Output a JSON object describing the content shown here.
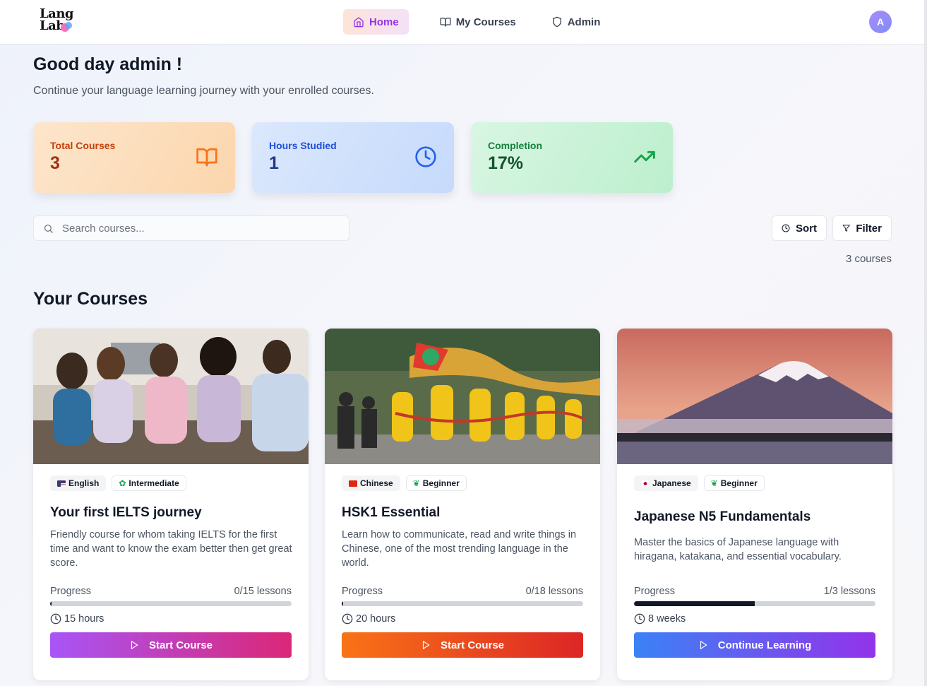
{
  "header": {
    "logo_line1": "Lang",
    "logo_line2": "Lab",
    "nav": [
      {
        "label": "Home",
        "active": true
      },
      {
        "label": "My Courses",
        "active": false
      },
      {
        "label": "Admin",
        "active": false
      }
    ],
    "avatar_initial": "A"
  },
  "greeting": "Good day admin !",
  "subtitle": "Continue your language learning journey with your enrolled courses.",
  "stats": [
    {
      "label": "Total Courses",
      "value": "3",
      "icon": "book-open-icon"
    },
    {
      "label": "Hours Studied",
      "value": "1",
      "icon": "clock-icon"
    },
    {
      "label": "Completion",
      "value": "17%",
      "icon": "trending-up-icon"
    }
  ],
  "search": {
    "placeholder": "Search courses..."
  },
  "controls": {
    "sort_label": "Sort",
    "filter_label": "Filter",
    "count_text": "3 courses"
  },
  "section_title": "Your Courses",
  "courses": [
    {
      "language": "English",
      "level": "Intermediate",
      "title": "Your first IELTS journey",
      "description": "Friendly course for whom taking IELTS for the first time and want to know the exam better then get great score.",
      "progress_label": "Progress",
      "progress_text": "0/15 lessons",
      "progress": 0,
      "duration": "15 hours",
      "cta": "Start Course"
    },
    {
      "language": "Chinese",
      "level": "Beginner",
      "title": "HSK1 Essential",
      "description": "Learn how to communicate, read and write things in Chinese, one of the most trending language in the world.",
      "progress_label": "Progress",
      "progress_text": "0/18 lessons",
      "progress": 0,
      "duration": "20 hours",
      "cta": "Start Course"
    },
    {
      "language": "Japanese",
      "level": "Beginner",
      "title": "Japanese N5 Fundamentals",
      "description": "Master the basics of Japanese language with hiragana, katakana, and essential vocabulary.",
      "progress_label": "Progress",
      "progress_text": "1/3 lessons",
      "progress": 0.5,
      "duration": "8 weeks",
      "cta": "Continue Learning"
    }
  ]
}
